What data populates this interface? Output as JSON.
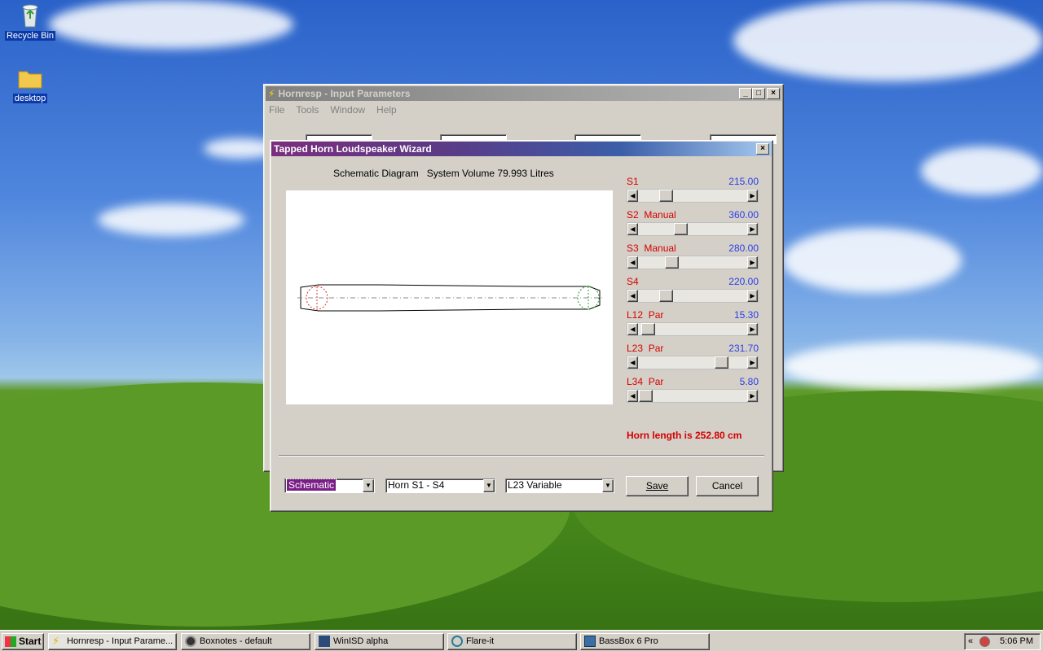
{
  "desktop": {
    "icons": [
      {
        "label": "Recycle Bin",
        "icon": "recycle-bin-icon"
      },
      {
        "label": "desktop",
        "icon": "folder-icon"
      }
    ]
  },
  "main_window": {
    "title": "Hornresp - Input Parameters",
    "menu": [
      "File",
      "Tools",
      "Window",
      "Help"
    ],
    "controls": [
      "minimize",
      "maximize",
      "close"
    ]
  },
  "wizard": {
    "title": "Tapped Horn Loudspeaker Wizard",
    "heading": "Schematic Diagram   System Volume 79.993 Litres",
    "sliders": [
      {
        "name": "S1",
        "value": "215.00",
        "position": 0.22
      },
      {
        "name": "S2  Manual",
        "value": "360.00",
        "position": 0.38
      },
      {
        "name": "S3  Manual",
        "value": "280.00",
        "position": 0.28
      },
      {
        "name": "S4",
        "value": "220.00",
        "position": 0.22
      },
      {
        "name": "L12  Par",
        "value": "15.30",
        "position": 0.03
      },
      {
        "name": "L23  Par",
        "value": "231.70",
        "position": 0.8
      },
      {
        "name": "L34  Par",
        "value": "5.80",
        "position": 0.01
      }
    ],
    "horn_length": "Horn length is 252.80 cm",
    "combos": {
      "view": "Schematic",
      "horn": "Horn S1 - S4",
      "mode": "L23 Variable"
    },
    "save_label": "Save",
    "cancel_label": "Cancel"
  },
  "taskbar": {
    "start_label": "Start",
    "tasks": [
      {
        "label": "Hornresp - Input Parame...",
        "icon": "lightning-icon"
      },
      {
        "label": "Boxnotes - default",
        "icon": "speaker-icon"
      },
      {
        "label": "WinISD alpha",
        "icon": "winisd-icon"
      },
      {
        "label": "Flare-it",
        "icon": "flare-icon"
      },
      {
        "label": "BassBox 6 Pro",
        "icon": "bassbox-icon"
      }
    ],
    "tray_chevron": "«",
    "clock": "5:06 PM"
  },
  "colors": {
    "title_active_start": "#7a2e7e",
    "title_active_end": "#a6caf0",
    "slider_name": "#d40000",
    "slider_value": "#2b3ee6",
    "horn_length_text": "#d40000"
  }
}
